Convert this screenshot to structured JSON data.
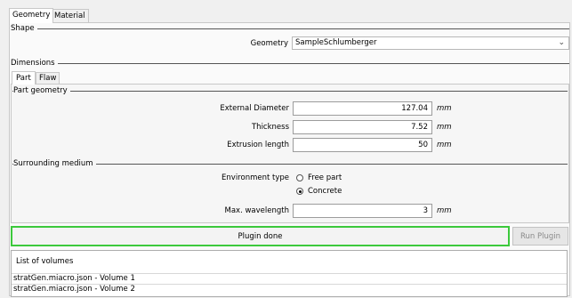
{
  "tabs": [
    "Geometry",
    "Material"
  ],
  "shape": {
    "label": "Shape",
    "geometry_label": "Geometry",
    "geometry_value": "SampleSchlumberger"
  },
  "dimensions": {
    "label": "Dimensions",
    "tabs": [
      "Part",
      "Flaw"
    ],
    "part_geometry": {
      "label": "Part geometry",
      "external_diameter_label": "External Diameter",
      "external_diameter_value": "127.04",
      "thickness_label": "Thickness",
      "thickness_value": "7.52",
      "extrusion_length_label": "Extrusion length",
      "extrusion_length_value": "50",
      "unit": "mm"
    },
    "surrounding_medium": {
      "label": "Surrounding medium",
      "environment_type_label": "Environment type",
      "options": [
        "Free part",
        "Concrete"
      ],
      "selected": "Concrete",
      "max_wavelength_label": "Max. wavelength",
      "max_wavelength_value": "3",
      "unit": "mm"
    }
  },
  "status": {
    "message": "Plugin done",
    "run_button_label": "Run Plugin",
    "border_color": "#3cc93c"
  },
  "volumes": {
    "header": "List of volumes",
    "items": [
      "stratGen.miacro.json - Volume 1",
      "stratGen.miacro.json - Volume 2"
    ]
  }
}
